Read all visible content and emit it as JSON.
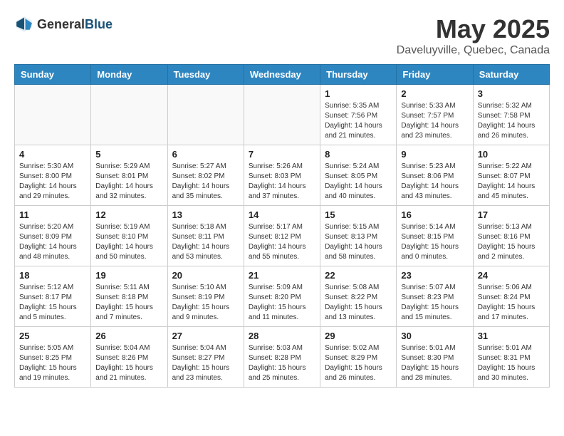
{
  "header": {
    "logo_general": "General",
    "logo_blue": "Blue",
    "month": "May 2025",
    "location": "Daveluyville, Quebec, Canada"
  },
  "days_of_week": [
    "Sunday",
    "Monday",
    "Tuesday",
    "Wednesday",
    "Thursday",
    "Friday",
    "Saturday"
  ],
  "weeks": [
    [
      {
        "day": "",
        "info": ""
      },
      {
        "day": "",
        "info": ""
      },
      {
        "day": "",
        "info": ""
      },
      {
        "day": "",
        "info": ""
      },
      {
        "day": "1",
        "info": "Sunrise: 5:35 AM\nSunset: 7:56 PM\nDaylight: 14 hours\nand 21 minutes."
      },
      {
        "day": "2",
        "info": "Sunrise: 5:33 AM\nSunset: 7:57 PM\nDaylight: 14 hours\nand 23 minutes."
      },
      {
        "day": "3",
        "info": "Sunrise: 5:32 AM\nSunset: 7:58 PM\nDaylight: 14 hours\nand 26 minutes."
      }
    ],
    [
      {
        "day": "4",
        "info": "Sunrise: 5:30 AM\nSunset: 8:00 PM\nDaylight: 14 hours\nand 29 minutes."
      },
      {
        "day": "5",
        "info": "Sunrise: 5:29 AM\nSunset: 8:01 PM\nDaylight: 14 hours\nand 32 minutes."
      },
      {
        "day": "6",
        "info": "Sunrise: 5:27 AM\nSunset: 8:02 PM\nDaylight: 14 hours\nand 35 minutes."
      },
      {
        "day": "7",
        "info": "Sunrise: 5:26 AM\nSunset: 8:03 PM\nDaylight: 14 hours\nand 37 minutes."
      },
      {
        "day": "8",
        "info": "Sunrise: 5:24 AM\nSunset: 8:05 PM\nDaylight: 14 hours\nand 40 minutes."
      },
      {
        "day": "9",
        "info": "Sunrise: 5:23 AM\nSunset: 8:06 PM\nDaylight: 14 hours\nand 43 minutes."
      },
      {
        "day": "10",
        "info": "Sunrise: 5:22 AM\nSunset: 8:07 PM\nDaylight: 14 hours\nand 45 minutes."
      }
    ],
    [
      {
        "day": "11",
        "info": "Sunrise: 5:20 AM\nSunset: 8:09 PM\nDaylight: 14 hours\nand 48 minutes."
      },
      {
        "day": "12",
        "info": "Sunrise: 5:19 AM\nSunset: 8:10 PM\nDaylight: 14 hours\nand 50 minutes."
      },
      {
        "day": "13",
        "info": "Sunrise: 5:18 AM\nSunset: 8:11 PM\nDaylight: 14 hours\nand 53 minutes."
      },
      {
        "day": "14",
        "info": "Sunrise: 5:17 AM\nSunset: 8:12 PM\nDaylight: 14 hours\nand 55 minutes."
      },
      {
        "day": "15",
        "info": "Sunrise: 5:15 AM\nSunset: 8:13 PM\nDaylight: 14 hours\nand 58 minutes."
      },
      {
        "day": "16",
        "info": "Sunrise: 5:14 AM\nSunset: 8:15 PM\nDaylight: 15 hours\nand 0 minutes."
      },
      {
        "day": "17",
        "info": "Sunrise: 5:13 AM\nSunset: 8:16 PM\nDaylight: 15 hours\nand 2 minutes."
      }
    ],
    [
      {
        "day": "18",
        "info": "Sunrise: 5:12 AM\nSunset: 8:17 PM\nDaylight: 15 hours\nand 5 minutes."
      },
      {
        "day": "19",
        "info": "Sunrise: 5:11 AM\nSunset: 8:18 PM\nDaylight: 15 hours\nand 7 minutes."
      },
      {
        "day": "20",
        "info": "Sunrise: 5:10 AM\nSunset: 8:19 PM\nDaylight: 15 hours\nand 9 minutes."
      },
      {
        "day": "21",
        "info": "Sunrise: 5:09 AM\nSunset: 8:20 PM\nDaylight: 15 hours\nand 11 minutes."
      },
      {
        "day": "22",
        "info": "Sunrise: 5:08 AM\nSunset: 8:22 PM\nDaylight: 15 hours\nand 13 minutes."
      },
      {
        "day": "23",
        "info": "Sunrise: 5:07 AM\nSunset: 8:23 PM\nDaylight: 15 hours\nand 15 minutes."
      },
      {
        "day": "24",
        "info": "Sunrise: 5:06 AM\nSunset: 8:24 PM\nDaylight: 15 hours\nand 17 minutes."
      }
    ],
    [
      {
        "day": "25",
        "info": "Sunrise: 5:05 AM\nSunset: 8:25 PM\nDaylight: 15 hours\nand 19 minutes."
      },
      {
        "day": "26",
        "info": "Sunrise: 5:04 AM\nSunset: 8:26 PM\nDaylight: 15 hours\nand 21 minutes."
      },
      {
        "day": "27",
        "info": "Sunrise: 5:04 AM\nSunset: 8:27 PM\nDaylight: 15 hours\nand 23 minutes."
      },
      {
        "day": "28",
        "info": "Sunrise: 5:03 AM\nSunset: 8:28 PM\nDaylight: 15 hours\nand 25 minutes."
      },
      {
        "day": "29",
        "info": "Sunrise: 5:02 AM\nSunset: 8:29 PM\nDaylight: 15 hours\nand 26 minutes."
      },
      {
        "day": "30",
        "info": "Sunrise: 5:01 AM\nSunset: 8:30 PM\nDaylight: 15 hours\nand 28 minutes."
      },
      {
        "day": "31",
        "info": "Sunrise: 5:01 AM\nSunset: 8:31 PM\nDaylight: 15 hours\nand 30 minutes."
      }
    ]
  ]
}
